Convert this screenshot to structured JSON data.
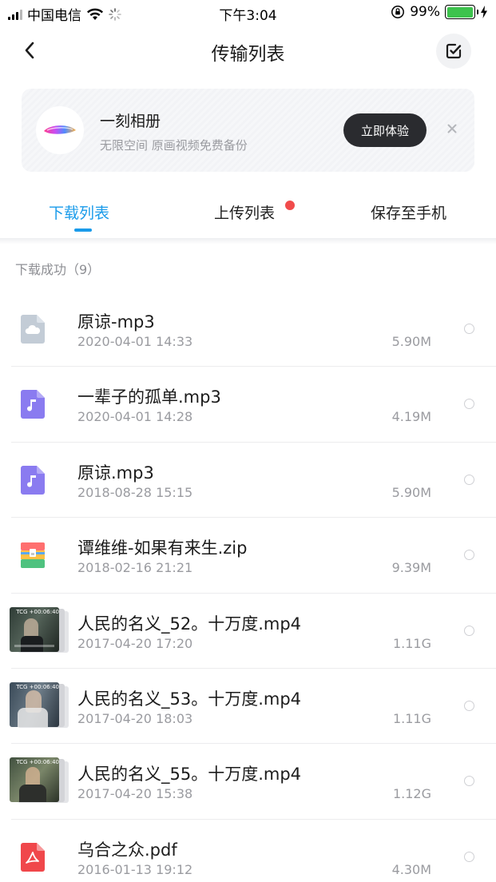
{
  "status_bar": {
    "carrier": "中国电信",
    "time": "下午3:04",
    "battery_pct": "99%",
    "battery_level": 0.99
  },
  "header": {
    "title": "传输列表"
  },
  "promo": {
    "title": "一刻相册",
    "subtitle": "无限空间 原画视频免费备份",
    "button": "立即体验"
  },
  "tabs": [
    {
      "label": "下载列表",
      "active": true,
      "badge": false
    },
    {
      "label": "上传列表",
      "active": false,
      "badge": true
    },
    {
      "label": "保存至手机",
      "active": false,
      "badge": false
    }
  ],
  "section": {
    "title": "下载成功（9）"
  },
  "files": [
    {
      "name": "原谅-mp3",
      "date": "2020-04-01 14:33",
      "size": "5.90M",
      "icon": "cloud-file-icon"
    },
    {
      "name": "一辈子的孤单.mp3",
      "date": "2020-04-01 14:28",
      "size": "4.19M",
      "icon": "music-file-icon"
    },
    {
      "name": "原谅.mp3",
      "date": "2018-08-28 15:15",
      "size": "5.90M",
      "icon": "music-file-icon"
    },
    {
      "name": "谭维维-如果有来生.zip",
      "date": "2018-02-16 21:21",
      "size": "9.39M",
      "icon": "zip-file-icon"
    },
    {
      "name": "人民的名义_52。十万度.mp4",
      "date": "2017-04-20 17:20",
      "size": "1.11G",
      "icon": "video-thumbnail"
    },
    {
      "name": "人民的名义_53。十万度.mp4",
      "date": "2017-04-20 18:03",
      "size": "1.11G",
      "icon": "video-thumbnail"
    },
    {
      "name": "人民的名义_55。十万度.mp4",
      "date": "2017-04-20 15:38",
      "size": "1.12G",
      "icon": "video-thumbnail"
    },
    {
      "name": "乌合之众.pdf",
      "date": "2016-01-13 19:12",
      "size": "4.30M",
      "icon": "pdf-file-icon"
    }
  ],
  "thumb_tag": "TCG +00:06:40",
  "colors": {
    "accent": "#1a9bea",
    "badge": "#f14b4b",
    "music_icon": "#8a7bf0",
    "pdf_icon": "#f0474b",
    "cloud_icon": "#c3ccd6"
  }
}
